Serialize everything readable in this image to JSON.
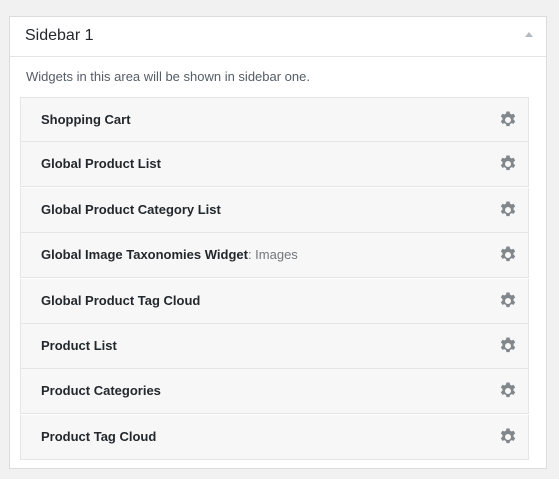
{
  "sidebar": {
    "title": "Sidebar 1",
    "description": "Widgets in this area will be shown in sidebar one.",
    "collapse_icon": "arrow-up-icon"
  },
  "widgets": [
    {
      "title": "Shopping Cart",
      "subtitle": ""
    },
    {
      "title": "Global Product List",
      "subtitle": ""
    },
    {
      "title": "Global Product Category List",
      "subtitle": ""
    },
    {
      "title": "Global Image Taxonomies Widget",
      "subtitle": ": Images"
    },
    {
      "title": "Global Product Tag Cloud",
      "subtitle": ""
    },
    {
      "title": "Product List",
      "subtitle": ""
    },
    {
      "title": "Product Categories",
      "subtitle": ""
    },
    {
      "title": "Product Tag Cloud",
      "subtitle": ""
    }
  ],
  "colors": {
    "gear": "#82878c",
    "title": "#23282d",
    "muted": "#72777c"
  },
  "icons": {
    "widget_action": "gear-icon"
  }
}
